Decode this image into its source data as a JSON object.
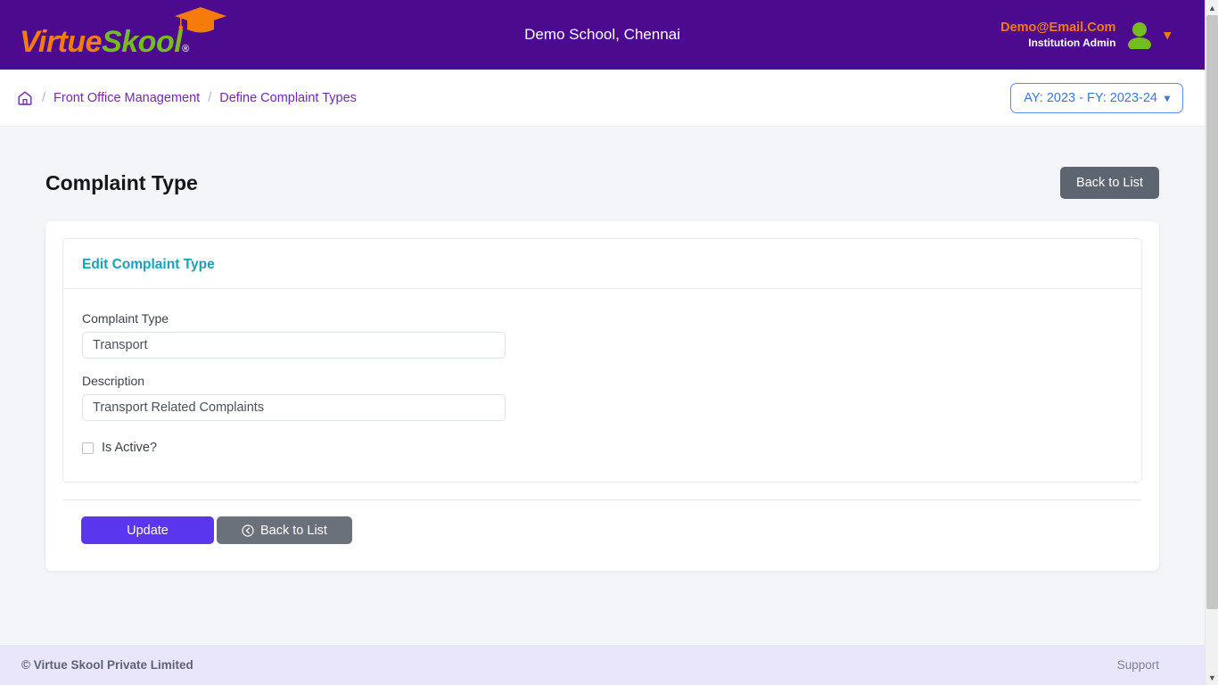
{
  "header": {
    "logo": {
      "part1": "Virtue",
      "part2": "Skool",
      "registered": "®",
      "cap_icon": "graduation-cap-icon"
    },
    "school_title": "Demo School, Chennai",
    "user": {
      "email": "Demo@Email.Com",
      "role": "Institution Admin",
      "avatar_icon": "user-avatar-icon",
      "chevron_icon": "chevron-down-icon"
    }
  },
  "breadcrumb": {
    "home_icon": "home-icon",
    "separator": "/",
    "items": [
      {
        "label": "Front Office Management"
      },
      {
        "label": "Define Complaint Types"
      }
    ]
  },
  "ay_selector": {
    "label": "AY: 2023 - FY: 2023-24",
    "chevron_icon": "chevron-down-icon"
  },
  "page": {
    "title": "Complaint Type",
    "back_to_list_label": "Back to List"
  },
  "form_card": {
    "title": "Edit Complaint Type",
    "fields": [
      {
        "label": "Complaint Type",
        "value": "Transport",
        "placeholder": "Complaint Type"
      },
      {
        "label": "Description",
        "value": "Transport Related Complaints",
        "placeholder": "Description"
      }
    ],
    "checkbox": {
      "label": "Is Active?",
      "checked": false
    },
    "actions": {
      "update_label": "Update",
      "back_label": "Back to List",
      "back_icon": "back-circle-arrow-icon"
    }
  },
  "footer": {
    "copyright": "© Virtue Skool Private Limited",
    "support": "Support"
  },
  "colors": {
    "header_purple": "#4c0b8f",
    "logo_orange": "#f57c0a",
    "logo_green": "#76bc21",
    "breadcrumb_purple": "#7526b5",
    "accent_teal": "#18a2b8",
    "primary_indigo": "#5a36ee",
    "grey_button": "#6b717a",
    "ay_blue": "#3a76d8",
    "footer_lavender": "#e9e6fb"
  },
  "scrollbar": {
    "up_arrow_icon": "scroll-up-arrow-icon",
    "down_arrow_icon": "scroll-down-arrow-icon"
  }
}
